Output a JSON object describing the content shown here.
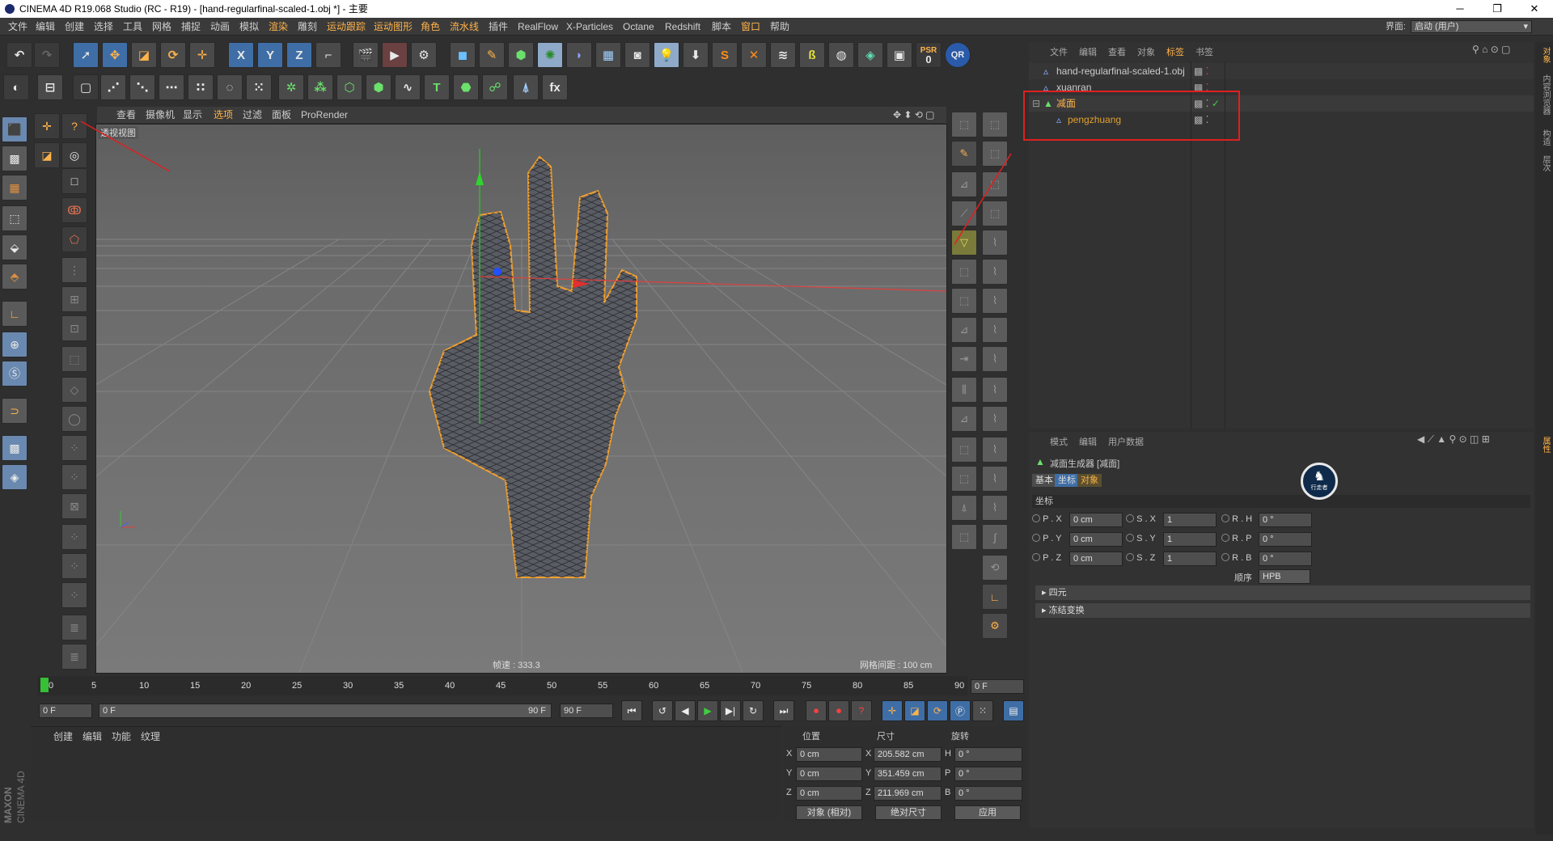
{
  "window": {
    "title": "CINEMA 4D R19.068 Studio (RC - R19) - [hand-regularfinal-scaled-1.obj *] - 主要",
    "min": "─",
    "max": "❐",
    "close": "✕"
  },
  "menubar": {
    "items": [
      "文件",
      "编辑",
      "创建",
      "选择",
      "工具",
      "网格",
      "捕捉",
      "动画",
      "模拟",
      "渲染",
      "雕刻",
      "运动跟踪",
      "运动图形",
      "角色",
      "流水线",
      "插件",
      "RealFlow",
      "X-Particles",
      "Octane",
      "Redshift",
      "脚本",
      "窗口",
      "帮助"
    ],
    "layout_label": "界面:",
    "layout_value": "启动 (用户)"
  },
  "toolbar": {
    "undo_icon": "undo-icon",
    "redo_icon": "redo-icon",
    "x": "X",
    "y": "Y",
    "z": "Z",
    "psr_label": "PSR",
    "psr_value": "0"
  },
  "viewport": {
    "menus": [
      "查看",
      "摄像机",
      "显示",
      "选项",
      "过滤",
      "面板",
      "ProRender"
    ],
    "view_name": "透视视图",
    "fps": "帧速 : 333.3",
    "grid": "网格间距 : 100 cm"
  },
  "timeline": {
    "ticks": [
      "0",
      "5",
      "10",
      "15",
      "20",
      "25",
      "30",
      "35",
      "40",
      "45",
      "50",
      "55",
      "60",
      "65",
      "70",
      "75",
      "80",
      "85",
      "90"
    ],
    "current": "0 F",
    "start": "0 F",
    "range_start": "0 F",
    "range_end": "90 F",
    "end": "90 F"
  },
  "materials": {
    "menus": [
      "创建",
      "编辑",
      "功能",
      "纹理"
    ],
    "brand_top": "MAXON",
    "brand_bottom": "CINEMA 4D"
  },
  "coords": {
    "headers": [
      "位置",
      "尺寸",
      "旋转"
    ],
    "rows": [
      {
        "a": "X",
        "pos": "0 cm",
        "b": "X",
        "size": "205.582 cm",
        "c": "H",
        "rot": "0 °"
      },
      {
        "a": "Y",
        "pos": "0 cm",
        "b": "Y",
        "size": "351.459 cm",
        "c": "P",
        "rot": "0 °"
      },
      {
        "a": "Z",
        "pos": "0 cm",
        "b": "Z",
        "size": "211.969 cm",
        "c": "B",
        "rot": "0 °"
      }
    ],
    "mode1": "对象 (相对)",
    "mode2": "绝对尺寸",
    "apply": "应用"
  },
  "object_manager": {
    "menus": [
      "文件",
      "编辑",
      "查看",
      "对象",
      "标签",
      "书签"
    ],
    "objects": [
      {
        "name": "hand-regularfinal-scaled-1.obj",
        "color": "#cccccc"
      },
      {
        "name": "xuanran",
        "color": "#cccccc"
      },
      {
        "name": "减面",
        "color": "#ffb34a"
      },
      {
        "name": "pengzhuang",
        "color": "#e0a030"
      }
    ]
  },
  "attributes": {
    "menus": [
      "模式",
      "编辑",
      "用户数据"
    ],
    "title": "减面生成器 [减面]",
    "tabs": [
      "基本",
      "坐标",
      "对象"
    ],
    "section": "坐标",
    "rows": [
      {
        "p": "P . X",
        "pv": "0 cm",
        "s": "S . X",
        "sv": "1",
        "r": "R . H",
        "rv": "0 °"
      },
      {
        "p": "P . Y",
        "pv": "0 cm",
        "s": "S . Y",
        "sv": "1",
        "r": "R . P",
        "rv": "0 °"
      },
      {
        "p": "P . Z",
        "pv": "0 cm",
        "s": "S . Z",
        "sv": "1",
        "r": "R . B",
        "rv": "0 °"
      }
    ],
    "order_label": "顺序",
    "order_value": "HPB",
    "group1": "▸ 四元",
    "group2": "▸ 冻结变换",
    "badge": "行走者"
  },
  "right_tabs": [
    "对象",
    "内容浏览器",
    "构造",
    "层次"
  ],
  "right_tabs2": [
    "属性"
  ]
}
